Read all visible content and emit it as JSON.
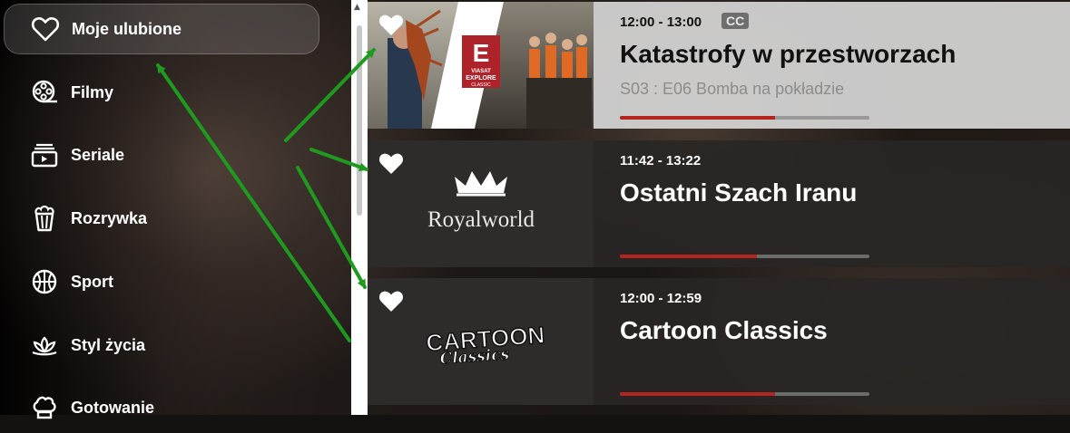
{
  "sidebar": {
    "items": [
      {
        "label": "Moje ulubione",
        "icon": "heart-icon",
        "active": true
      },
      {
        "label": "Filmy",
        "icon": "film-reel-icon"
      },
      {
        "label": "Seriale",
        "icon": "tv-series-icon"
      },
      {
        "label": "Rozrywka",
        "icon": "popcorn-icon"
      },
      {
        "label": "Sport",
        "icon": "basketball-icon"
      },
      {
        "label": "Styl życia",
        "icon": "lotus-icon"
      },
      {
        "label": "Gotowanie",
        "icon": "chef-hat-icon"
      }
    ]
  },
  "channels": [
    {
      "time": "12:00 - 13:00",
      "badge": "CC",
      "title": "Katastrofy w przestworzach",
      "subtitle": "S03 : E06 Bomba na pokładzie",
      "progress": 0.62,
      "logo": {
        "letter": "E",
        "line1": "VIASAT",
        "line2": "EXPLORE",
        "line3": "CLASSIC"
      },
      "highlighted": true
    },
    {
      "time": "11:42 - 13:22",
      "title": "Ostatni Szach Iranu",
      "progress": 0.55,
      "logo": {
        "text": "Royalworld"
      }
    },
    {
      "time": "12:00 - 12:59",
      "title": "Cartoon Classics",
      "progress": 0.62,
      "logo": {
        "line1": "CARTOON",
        "line2": "Classics"
      }
    }
  ],
  "colors": {
    "accent": "#b3251e",
    "annotation": "#1f9a1f"
  }
}
